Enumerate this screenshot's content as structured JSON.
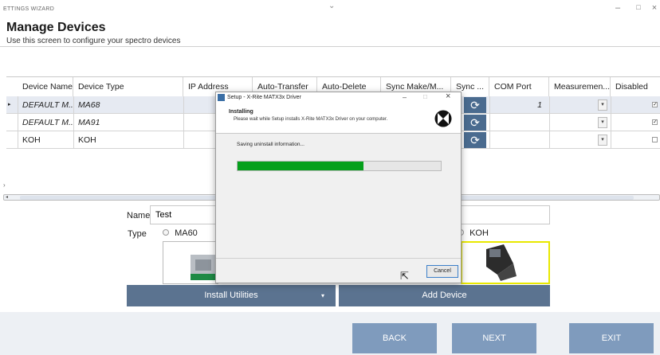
{
  "window": {
    "title": "ETTINGS WIZARD",
    "minimize": "–",
    "maximize": "□",
    "close": "×"
  },
  "header": {
    "title": "Manage Devices",
    "subtitle": "Use this screen to configure your spectro devices"
  },
  "grid": {
    "columns": [
      "Device Name ▴",
      "Device Type",
      "IP Address",
      "Auto-Transfer",
      "Auto-Delete",
      "Sync Make/M...",
      "Sync ...",
      "COM Port",
      "Measuremen...",
      "Disabled"
    ],
    "rows": [
      {
        "indicator": "▸",
        "name": "DEFAULT M...",
        "type": "MA68",
        "com_port": "1",
        "disabled": true,
        "italic": true
      },
      {
        "indicator": "",
        "name": "DEFAULT M...",
        "type": "MA91",
        "com_port": "",
        "disabled": true,
        "italic": true
      },
      {
        "indicator": "",
        "name": "KOH",
        "type": "KOH",
        "com_port": "",
        "disabled": false,
        "italic": false
      }
    ],
    "dropdown_glyph": "▾"
  },
  "form": {
    "name_label": "Name",
    "name_value": "Test",
    "type_label": "Type",
    "type_option_1": "MA60",
    "type_option_koh": "KOH"
  },
  "buttons": {
    "install_utilities": "Install Utilities",
    "add_device": "Add Device",
    "back": "BACK",
    "next": "NEXT",
    "exit": "EXIT"
  },
  "dialog": {
    "title": "Setup - X-Rite MATX3x Driver",
    "heading": "Installing",
    "description": "Please wait while Setup installs X-Rite MATX3x Driver on your computer.",
    "status": "Saving uninstall information...",
    "progress": 0.62,
    "cancel": "Cancel",
    "minimize": "–",
    "maximize": "□",
    "close": "×"
  },
  "colors": {
    "accent": "#5b7390",
    "nav_button": "#7f9bbd",
    "progress": "#06a01c",
    "selected_border": "#e8e800"
  }
}
